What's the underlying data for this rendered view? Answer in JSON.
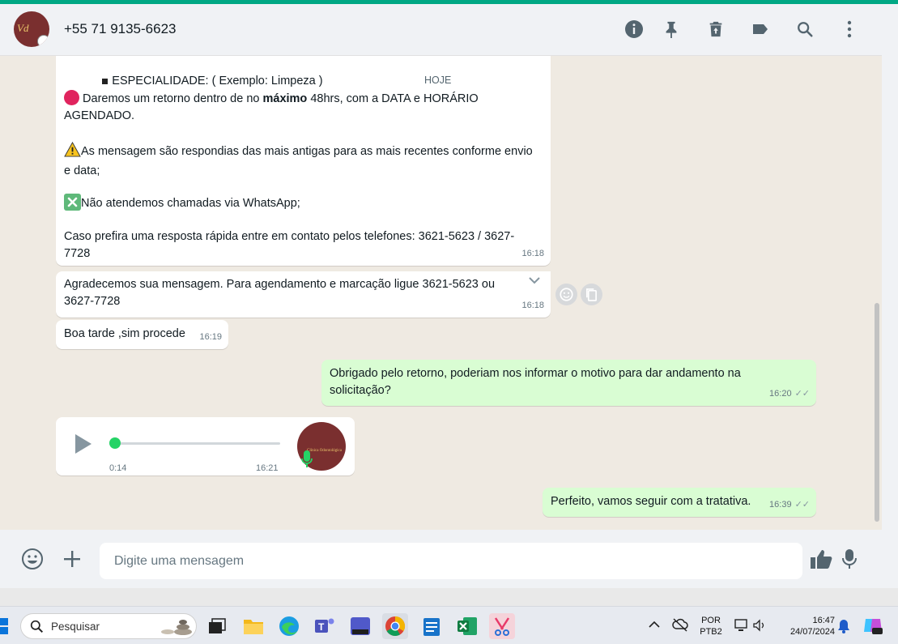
{
  "header": {
    "contact_name": "+55 71 9135-6623",
    "icons": [
      "info-icon",
      "pin-icon",
      "delete-icon",
      "label-icon",
      "search-icon",
      "menu-icon"
    ]
  },
  "chat": {
    "date_chip": "HOJE",
    "msg1": {
      "line_top": "ESPECIALIDADE: ( Exemplo: Limpeza )",
      "p1_pre": " Daremos um retorno dentro de no ",
      "p1_bold": "máximo",
      "p1_post": " 48hrs, com a DATA e HORÁRIO AGENDADO.",
      "p2": "As mensagem são respondias das mais antigas para as mais recentes conforme envio e data;",
      "p3": "Não atendemos chamadas via WhatsApp;",
      "p4": "Caso prefira uma resposta rápida entre em contato pelos telefones: 3621-5623 / 3627-7728",
      "time": "16:18"
    },
    "msg2": {
      "text": "Agradecemos sua mensagem. Para agendamento e marcação ligue 3621-5623 ou 3627-7728",
      "time": "16:18"
    },
    "msg3": {
      "text": "Boa tarde ,sim procede",
      "time": "16:19"
    },
    "msg4": {
      "text": "Obrigado pelo retorno, poderiam nos informar o motivo para dar andamento na solicitação?",
      "time": "16:20"
    },
    "audio": {
      "duration": "0:14",
      "time": "16:21",
      "progress": 0.0,
      "avatar_text": "Clínica Odontológica"
    },
    "msg5": {
      "text": "Perfeito, vamos seguir com a tratativa.",
      "time": "16:39"
    }
  },
  "composer": {
    "placeholder": "Digite uma mensagem"
  },
  "taskbar": {
    "search_label": "Pesquisar",
    "lang_top": "POR",
    "lang_bottom": "PTB2",
    "clock_time": "16:47",
    "clock_date": "24/07/2024"
  },
  "colors": {
    "accent": "#00a884",
    "outgoing_bubble": "#d9fdd3",
    "incoming_bubble": "#ffffff",
    "chat_bg": "#efeae2"
  }
}
